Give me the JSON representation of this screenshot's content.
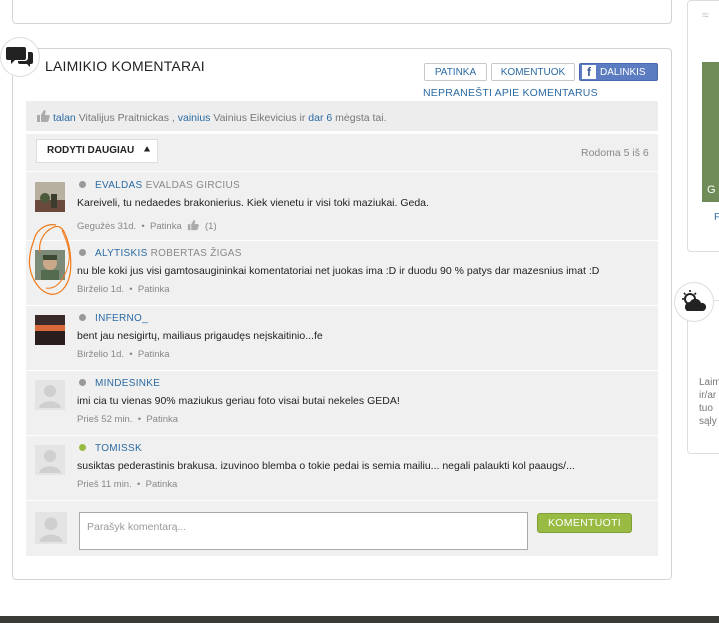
{
  "section": {
    "title": "LAIMIKIO KOMENTARAI",
    "buttons": {
      "like": "PATINKA",
      "comment": "KOMENTUOK",
      "share": "DALINKIS",
      "fb_letter": "f"
    },
    "report_link": "NEPRANEŠTI APIE KOMENTARUS"
  },
  "likes": {
    "user1": "talan",
    "name1": "Vitalijus Praitnickas",
    "sep": ",",
    "user2": "vainius",
    "name2": "Vainius Eikevicius",
    "or": "ir",
    "more": "dar 6",
    "suffix": "mėgsta tai."
  },
  "controls": {
    "show_more": "RODYTI DAUGIAU",
    "shown_count": "Rodoma 5 iš 6"
  },
  "comments": [
    {
      "username": "EVALDAS",
      "realname": "EVALDAS GIRCIUS",
      "text": "Kareiveli, tu nedaedes brakonierius. Kiek vienetu ir visi toki maziukai. Geda.",
      "date": "Gegužės 31d.",
      "like_label": "Patinka",
      "like_count": "(1)",
      "online": false
    },
    {
      "username": "ALYTISKIS",
      "realname": "ROBERTAS ŽIGAS",
      "text": "nu ble koki jus visi gamtosaugininkai komentatoriai net juokas ima :D ir duodu 90 % patys dar mazesnius imat :D",
      "date": "Birželio 1d.",
      "like_label": "Patinka",
      "online": false
    },
    {
      "username": "INFERNO_",
      "realname": "",
      "text": "bent jau nesigirtų, mailiaus prigaudęs neįskaitinio...fe",
      "date": "Birželio 1d.",
      "like_label": "Patinka",
      "online": false
    },
    {
      "username": "MINDESINKE",
      "realname": "",
      "text": "imi cia tu vienas 90% maziukus geriau foto visai butai nekeles GEDA!",
      "date": "Prieš 52 min.",
      "like_label": "Patinka",
      "online": false
    },
    {
      "username": "TOMISSK",
      "realname": "",
      "text": "susiktas pederastinis brakusa. izuvinoo blemba o tokie pedai is semia mailiu... negali palaukti kol paaugs/...",
      "date": "Prieš 11 min.",
      "like_label": "Patinka",
      "online": true
    }
  ],
  "comment_form": {
    "placeholder": "Parašyk komentarą...",
    "submit": "KOMENTUOTI"
  },
  "sidebar": {
    "link_fragment": "F",
    "photo_text": "G",
    "text_lines": [
      "Laim",
      "ir/ar",
      "tuo",
      "sąly"
    ]
  },
  "colors": {
    "link": "#2b6aa3",
    "accent_green": "#99bb44",
    "facebook": "#5b7cc0",
    "online": "#99bb44",
    "offline": "#999999"
  }
}
